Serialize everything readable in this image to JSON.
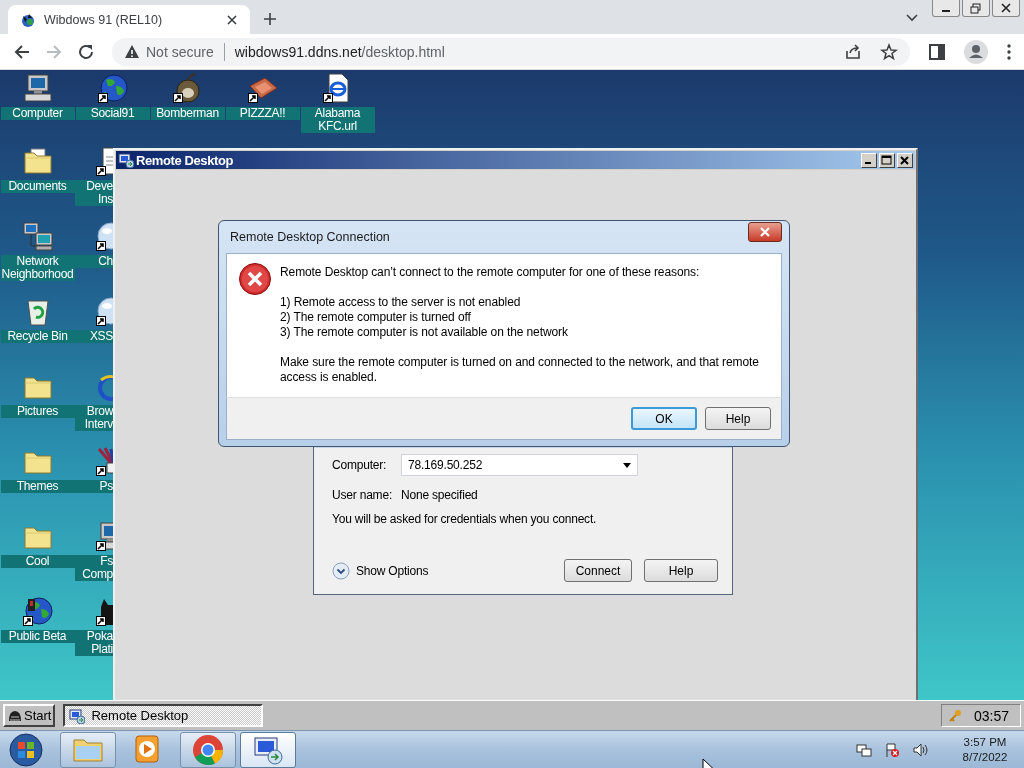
{
  "browser": {
    "tabs": [
      {
        "title": "Wibdows 91 (REL10)",
        "selected": true
      }
    ],
    "nav": {
      "back_disabled": false,
      "forward_disabled": true
    },
    "address_bar": {
      "security_label": "Not secure",
      "url_host": "wibdows91.ddns.net",
      "url_path": "/desktop.html"
    }
  },
  "desktop": {
    "top_row": [
      {
        "label": "Computer",
        "kind": "computer",
        "shortcut": false
      },
      {
        "label": "Social91",
        "kind": "globe",
        "shortcut": true
      },
      {
        "label": "Bomberman",
        "kind": "bomb",
        "shortcut": true
      },
      {
        "label": "PIZZZA!!",
        "kind": "pizza",
        "shortcut": true
      },
      {
        "label": "Alabama KFC.url",
        "kind": "web-file",
        "shortcut": true
      }
    ],
    "columns": [
      [
        {
          "label": "Documents",
          "kind": "documents",
          "shortcut": false
        },
        {
          "label": "Network Neighborhood",
          "kind": "network",
          "shortcut": false
        },
        {
          "label": "Recycle Bin",
          "kind": "recycle",
          "shortcut": false
        },
        {
          "label": "Pictures",
          "kind": "folder",
          "shortcut": false
        },
        {
          "label": "Themes",
          "kind": "folder",
          "shortcut": false
        },
        {
          "label": "Cool",
          "kind": "folder",
          "shortcut": false
        },
        {
          "label": "Public Beta",
          "kind": "globe-figure",
          "shortcut": true
        }
      ],
      [
        {
          "label": "Deve Ins",
          "kind": "document",
          "shortcut": true
        },
        {
          "label": "Ch",
          "kind": "sphere",
          "shortcut": true
        },
        {
          "label": "XSS",
          "kind": "sphere",
          "shortcut": true
        },
        {
          "label": "Brow Interv",
          "kind": "ring",
          "shortcut": false
        },
        {
          "label": "Ps",
          "kind": "brushes",
          "shortcut": true
        },
        {
          "label": "Fs Comp",
          "kind": "computer",
          "shortcut": true
        },
        {
          "label": "Poka Plati",
          "kind": "cat",
          "shortcut": true
        }
      ]
    ]
  },
  "remote_desktop_window": {
    "title": "Remote Desktop",
    "connection_panel": {
      "computer_label": "Computer:",
      "computer_value": "78.169.50.252",
      "user_label": "User name:",
      "user_value": "None specified",
      "note": "You will be asked for credentials when you connect.",
      "show_options": "Show Options",
      "buttons": [
        "Connect",
        "Help"
      ]
    }
  },
  "error_dialog": {
    "title": "Remote Desktop Connection",
    "intro": "Remote Desktop can’t connect to the remote computer for one of these reasons:",
    "reasons": [
      "1) Remote access to the server is not enabled",
      "2) The remote computer is turned off",
      "3) The remote computer is not available on the network"
    ],
    "advice": "Make sure the remote computer is turned on and connected to the network, and that remote access is enabled.",
    "buttons": [
      {
        "label": "OK",
        "focused": true
      },
      {
        "label": "Help",
        "focused": false
      }
    ]
  },
  "retro_taskbar": {
    "start_label": "Start",
    "tasks": [
      {
        "label": "Remote Desktop",
        "selected": true
      }
    ],
    "clock": "03:57"
  },
  "win7_taskbar": {
    "pinned": [
      {
        "kind": "explorer",
        "running": true,
        "active": false
      },
      {
        "kind": "media-player",
        "running": false,
        "active": false
      },
      {
        "kind": "browser",
        "running": true,
        "active": false
      },
      {
        "kind": "remote-desktop",
        "running": true,
        "active": true
      }
    ],
    "time": "3:57 PM",
    "date": "8/7/2022"
  }
}
